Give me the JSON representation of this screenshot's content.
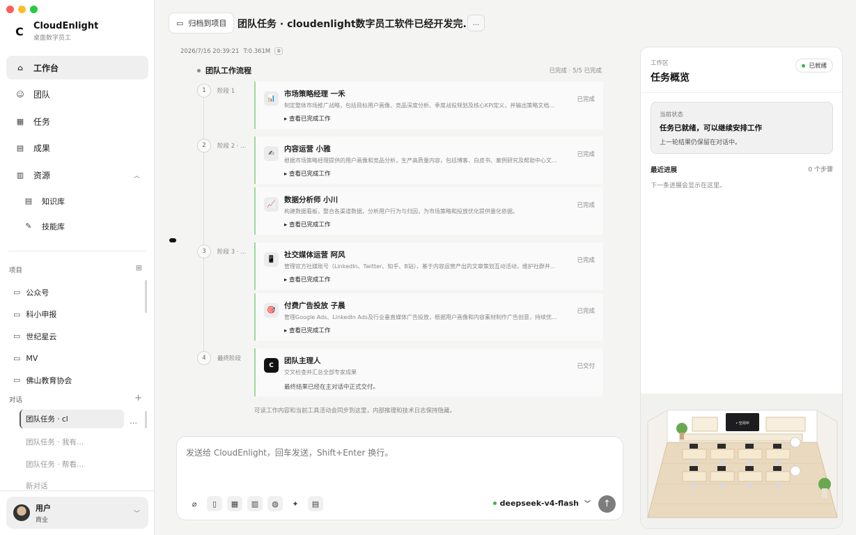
{
  "app": {
    "name": "CloudEnlight",
    "subtitle": "桌面数字员工",
    "logo": "C"
  },
  "window_controls": [
    {
      "name": "close",
      "color": "#ff5f57"
    },
    {
      "name": "minimize",
      "color": "#febc2e"
    },
    {
      "name": "zoom",
      "color": "#28c840"
    }
  ],
  "nav": [
    {
      "id": "workbench",
      "label": "工作台",
      "icon": "home-icon",
      "active": true
    },
    {
      "id": "team",
      "label": "团队",
      "icon": "users-icon"
    },
    {
      "id": "tasks",
      "label": "任务",
      "icon": "calendar-icon"
    },
    {
      "id": "results",
      "label": "成果",
      "icon": "document-icon"
    },
    {
      "id": "resources",
      "label": "资源",
      "icon": "book-icon",
      "expanded": true
    }
  ],
  "nav_sub": [
    {
      "id": "knowledge",
      "label": "知识库",
      "icon": "book-icon"
    },
    {
      "id": "skills",
      "label": "技能库",
      "icon": "skill-icon"
    }
  ],
  "projects": {
    "label": "项目",
    "items": [
      "公众号",
      "科小申报",
      "世纪星云",
      "MV",
      "佛山教育协会"
    ]
  },
  "conversations": {
    "label": "对话",
    "items": [
      "团队任务 · cl",
      "团队任务 · 我有...",
      "团队任务 · 帮看...",
      "新对话"
    ]
  },
  "user": {
    "name": "用户",
    "role": "商业"
  },
  "header": {
    "archive_label": "归档到项目",
    "title": "团队任务 · cloudenlight数字员工软件已经开发完...",
    "more_label": "..."
  },
  "meta": {
    "time": "2026/7/16 20:39:21",
    "tokens": "T:0.361M"
  },
  "flow": {
    "title": "团队工作流程",
    "status": "已完成 · 5/5 已完成",
    "stages": [
      {
        "num": "1",
        "label": "阶段 1"
      },
      {
        "num": "2",
        "label": "阶段 2 · ..."
      },
      {
        "num": "3",
        "label": "阶段 3 · ..."
      },
      {
        "num": "4",
        "label": "最终阶段"
      }
    ],
    "cards": [
      {
        "icon": "📊",
        "title": "市场策略经理 一禾",
        "desc": "制定整体市场推广战略，包括目标用户画像、竞品深度分析、季度战役规划及核心KPI定义，并输出策略文档...",
        "link": "▸ 查看已完成工作",
        "status": "已完成"
      },
      {
        "icon": "✍",
        "title": "内容运营 小雅",
        "desc": "根据市场策略经理提供的用户画像和竞品分析，生产高质量内容，包括博客、白皮书、案例研究及帮助中心文...",
        "link": "▸ 查看已完成工作",
        "status": "已完成"
      },
      {
        "icon": "📈",
        "title": "数据分析师 小川",
        "desc": "构建数据看板，整合各渠道数据，分析用户行为与归因，为市场策略和投放优化提供量化依据。",
        "link": "▸ 查看已完成工作",
        "status": "已完成"
      },
      {
        "icon": "📱",
        "title": "社交媒体运营 阿风",
        "desc": "管理官方社媒账号（LinkedIn、Twitter、知乎、B站），基于内容运营产出的文章策划互动活动，维护社群并...",
        "link": "▸ 查看已完成工作",
        "status": "已完成"
      },
      {
        "icon": "🎯",
        "title": "付费广告投放 子晨",
        "desc": "管理Google Ads、LinkedIn Ads及行业垂直媒体广告投放，根据用户画像和内容素材制作广告创意，持续优...",
        "link": "▸ 查看已完成工作",
        "status": "已完成"
      },
      {
        "icon": "C",
        "title": "团队主理人",
        "desc": "交叉检查并汇总全部专家成果",
        "link": "最终结果已经在主对话中正式交付。",
        "status": "已交付"
      }
    ],
    "footnote": "可读工作内容和当前工具活动会同步到这里，内部推理和技术日志保持隐藏。"
  },
  "composer": {
    "placeholder": "发送给 CloudEnlight，回车发送，Shift+Enter 换行。",
    "tools": [
      "attach-icon",
      "tablet-icon",
      "layout-icon",
      "building-icon",
      "globe-icon",
      "sparkle-icon",
      "file-icon"
    ],
    "model": "deepseek-v4-flash"
  },
  "panel": {
    "kicker": "工作区",
    "title": "任务概览",
    "badge": "已就绪",
    "status_kicker": "当前状态",
    "status_main": "任务已就绪，可以继续安排工作",
    "status_sub": "上一轮结果仍保留在对话中。",
    "progress_label": "最近进展",
    "progress_count": "0 个步骤",
    "progress_empty": "下一条进展会显示在这里。",
    "office_screen_text": "• 空闲中"
  },
  "colors": {
    "accent_green": "#9ed89b",
    "ready_green": "#3cb44b",
    "send_gray": "#7d7d7d"
  }
}
